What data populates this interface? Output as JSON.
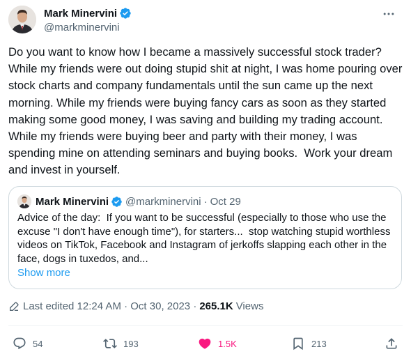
{
  "author": {
    "name": "Mark Minervini",
    "handle": "@markminervini",
    "avatar_icon": "avatar-portrait-icon",
    "verified_color": "#1d9bf0"
  },
  "tweet": {
    "text": "Do you want to know how I became a massively successful stock trader? While my friends were out doing stupid shit at night, I was home pouring over stock charts and company fundamentals until the sun came up the next morning. While my friends were buying fancy cars as soon as they started making some good money, I was saving and building my trading account. While my friends were buying beer and party with their money, I was spending mine on attending seminars and buying books.  Work your dream and invest in yourself."
  },
  "quoted": {
    "name": "Mark Minervini",
    "handle": "@markminervini",
    "separator": "·",
    "date": "Oct 29",
    "text": "Advice of the day:  If you want to be successful (especially to those who use the excuse \"I don't have enough time\"), for starters...  stop watching stupid worthless videos on TikTok, Facebook and Instagram of jerkoffs slapping each other in the face, dogs in tuxedos, and...",
    "show_more": "Show more"
  },
  "meta": {
    "edited": "Last edited 12:24 AM · Oct 30, 2023 ·",
    "views_count": "265.1K",
    "views_label": "Views"
  },
  "actions": {
    "replies": "54",
    "retweets": "193",
    "likes": "1.5K",
    "bookmarks": "213"
  },
  "colors": {
    "text": "#0f1419",
    "secondary": "#536471",
    "link": "#1d9bf0",
    "like": "#f91880",
    "border": "#cfd9de"
  }
}
